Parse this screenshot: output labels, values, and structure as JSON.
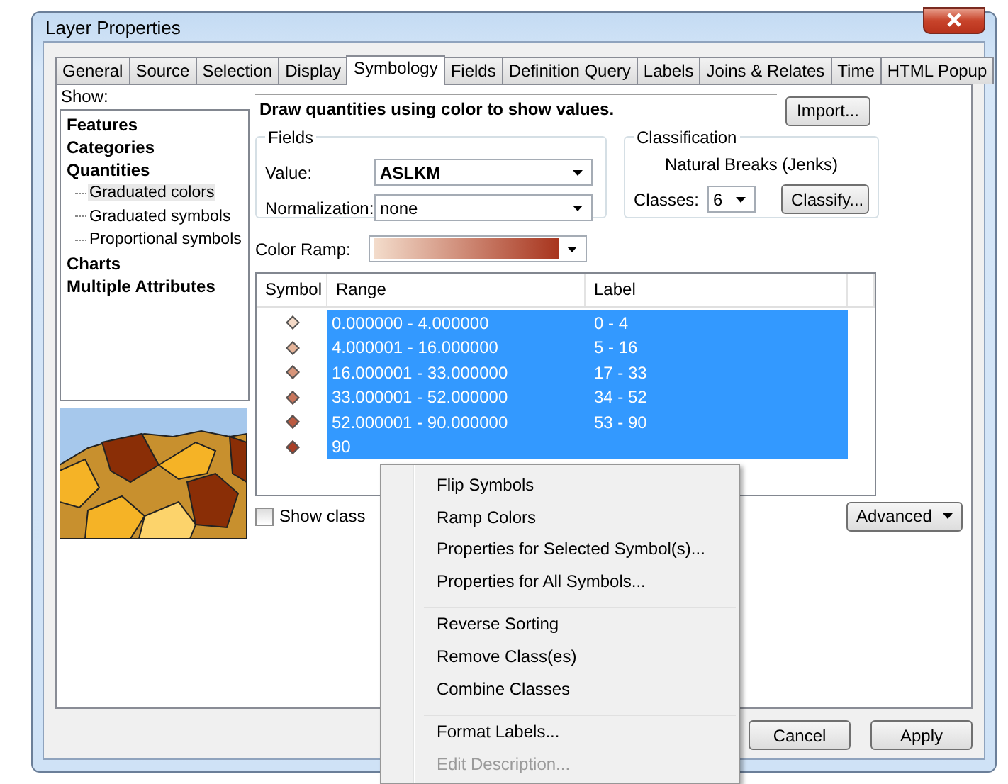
{
  "window": {
    "title": "Layer Properties"
  },
  "tabs": [
    {
      "label": "General",
      "selected": false
    },
    {
      "label": "Source",
      "selected": false
    },
    {
      "label": "Selection",
      "selected": false
    },
    {
      "label": "Display",
      "selected": false
    },
    {
      "label": "Symbology",
      "selected": true
    },
    {
      "label": "Fields",
      "selected": false
    },
    {
      "label": "Definition Query",
      "selected": false
    },
    {
      "label": "Labels",
      "selected": false
    },
    {
      "label": "Joins & Relates",
      "selected": false
    },
    {
      "label": "Time",
      "selected": false
    },
    {
      "label": "HTML Popup",
      "selected": false
    }
  ],
  "show": {
    "label": "Show:",
    "tree": [
      {
        "label": "Features"
      },
      {
        "label": "Categories"
      },
      {
        "label": "Quantities",
        "children": [
          {
            "label": "Graduated colors",
            "selected": true
          },
          {
            "label": "Graduated symbols",
            "selected": false
          },
          {
            "label": "Proportional symbols",
            "selected": false
          }
        ]
      },
      {
        "label": "Charts"
      },
      {
        "label": "Multiple Attributes"
      }
    ]
  },
  "description": "Draw quantities using color to show values.",
  "import_button": "Import...",
  "fields": {
    "title": "Fields",
    "value_label": "Value:",
    "value": "ASLKM",
    "normalization_label": "Normalization:",
    "normalization": "none"
  },
  "classification": {
    "title": "Classification",
    "method": "Natural Breaks (Jenks)",
    "classes_label": "Classes:",
    "classes": "6",
    "classify_button": "Classify..."
  },
  "color_ramp": {
    "label": "Color Ramp:"
  },
  "table": {
    "columns": [
      "Symbol",
      "Range",
      "Label"
    ],
    "rows": [
      {
        "range": "0.000000 - 4.000000",
        "label": "0 - 4",
        "color": "#f4d9c6",
        "selected": true
      },
      {
        "range": "4.000001 - 16.000000",
        "label": "5 - 16",
        "color": "#e6b59a",
        "selected": true
      },
      {
        "range": "16.000001 - 33.000000",
        "label": "17 - 33",
        "color": "#d8957a",
        "selected": true
      },
      {
        "range": "33.000001 - 52.000000",
        "label": "34 - 52",
        "color": "#c9765c",
        "selected": true
      },
      {
        "range": "52.000001 - 90.000000",
        "label": "53 - 90",
        "color": "#bb5a40",
        "selected": true
      },
      {
        "range": "90",
        "label": "",
        "color": "#aa3e26",
        "selected": true
      }
    ]
  },
  "show_class_checkbox": {
    "label": "Show class",
    "checked": false
  },
  "advanced_button": "Advanced",
  "buttons": [
    "Cancel",
    "Apply"
  ],
  "context_menu": [
    {
      "label": "Flip Symbols",
      "disabled": false,
      "separator_before": false
    },
    {
      "label": "Ramp Colors",
      "disabled": false,
      "separator_before": false
    },
    {
      "label": "Properties for Selected Symbol(s)...",
      "disabled": false,
      "separator_before": false
    },
    {
      "label": "Properties for All Symbols...",
      "disabled": false,
      "separator_before": false
    },
    {
      "label": "Reverse Sorting",
      "disabled": false,
      "separator_before": true
    },
    {
      "label": "Remove Class(es)",
      "disabled": false,
      "separator_before": false
    },
    {
      "label": "Combine Classes",
      "disabled": false,
      "separator_before": false
    },
    {
      "label": "Format Labels...",
      "disabled": false,
      "separator_before": true
    },
    {
      "label": "Edit Description...",
      "disabled": true,
      "separator_before": false
    }
  ]
}
